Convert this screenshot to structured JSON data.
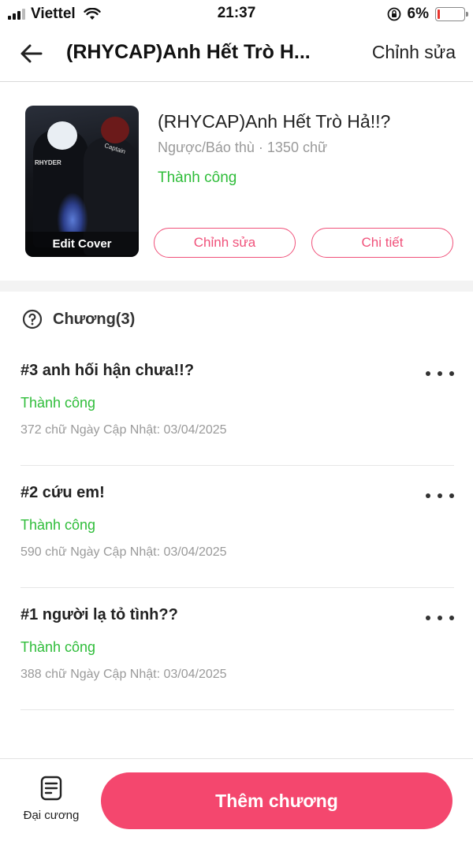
{
  "status_bar": {
    "carrier": "Viettel",
    "time": "21:37",
    "battery_percent": "6%",
    "battery_level": 0.06
  },
  "nav": {
    "title": "(RHYCAP)Anh Hết Trò H...",
    "edit_label": "Chỉnh sửa"
  },
  "book": {
    "cover_label": "Edit Cover",
    "cover_text_1": "RHYDER",
    "cover_text_2": "Captain",
    "title": "(RHYCAP)Anh Hết Trò Hả!!?",
    "meta": "Ngược/Báo thù · 1350 chữ",
    "status": "Thành công",
    "edit_button": "Chỉnh sửa",
    "detail_button": "Chi tiết"
  },
  "chapters_header": "Chương(3)",
  "chapters": [
    {
      "title": "#3 anh hối hận chưa!!?",
      "status": "Thành công",
      "meta": "372 chữ Ngày Cập Nhật: 03/04/2025"
    },
    {
      "title": "#2 cứu em!",
      "status": "Thành công",
      "meta": "590 chữ Ngày Cập Nhật: 03/04/2025"
    },
    {
      "title": "#1 người lạ tỏ tình??",
      "status": "Thành công",
      "meta": "388 chữ Ngày Cập Nhật: 03/04/2025"
    }
  ],
  "bottom": {
    "outline_label": "Đại cương",
    "add_chapter_label": "Thêm chương"
  },
  "colors": {
    "accent": "#f4476e",
    "success": "#2fbd3a",
    "muted": "#9a9a9a"
  },
  "icons": [
    "back-arrow-icon",
    "help-circle-icon",
    "more-dots-icon",
    "document-icon",
    "wifi-icon",
    "rotation-lock-icon",
    "battery-icon",
    "signal-icon"
  ]
}
